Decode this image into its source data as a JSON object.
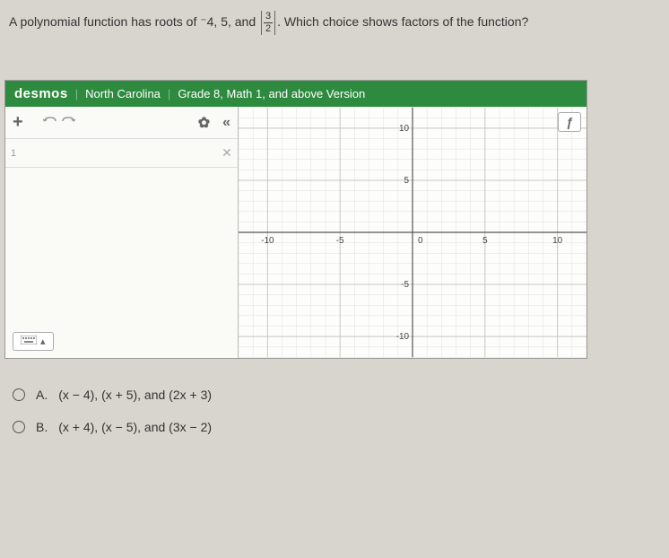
{
  "question": {
    "prefix": "A polynomial function has roots of ⁻4, 5, and ",
    "frac_num": "3",
    "frac_den": "2",
    "suffix": ". Which choice shows factors of the function?"
  },
  "desmos": {
    "logo": "desmos",
    "region": "North Carolina",
    "version": "Grade 8, Math 1, and above Version",
    "toolbar": {
      "add": "+",
      "gear": "✿",
      "collapse": "«"
    },
    "expr_close": "✕",
    "keyboard_arrow": "▴",
    "graph_tool": "ƒ"
  },
  "chart_data": {
    "type": "scatter",
    "title": "",
    "xlabel": "",
    "ylabel": "",
    "xlim": [
      -12,
      12
    ],
    "ylim": [
      -12,
      12
    ],
    "xticks": [
      -10,
      -5,
      0,
      5,
      10
    ],
    "yticks": [
      -10,
      -5,
      5,
      10
    ],
    "series": []
  },
  "answers": {
    "a_label": "A.",
    "a_text": "(x − 4), (x + 5), and (2x + 3)",
    "b_label": "B.",
    "b_text": "(x + 4), (x − 5), and (3x − 2)"
  }
}
